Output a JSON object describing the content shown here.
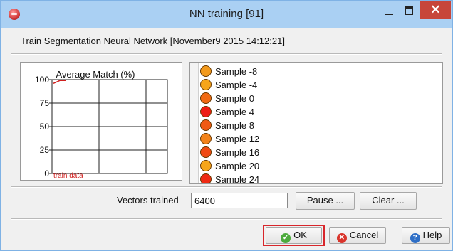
{
  "window": {
    "title": "NN training [91]",
    "close_glyph": "✕"
  },
  "header": {
    "label": "Train Segmentation Neural Network  [November9 2015 14:12:21]"
  },
  "chart_data": {
    "type": "line",
    "title": "Average Match (%)",
    "ylim": [
      0,
      100
    ],
    "yticks": [
      "100",
      "75",
      "50",
      "25",
      "0"
    ],
    "grid": true,
    "series": [
      {
        "name": "train data",
        "color": "#d0201f",
        "x": [
          0,
          1,
          2
        ],
        "y": [
          96,
          99,
          99
        ]
      }
    ],
    "legend_placement": "bottom-left"
  },
  "samples": [
    {
      "label": "Sample -8",
      "color": "#f39a1c"
    },
    {
      "label": "Sample -4",
      "color": "#f6a51a"
    },
    {
      "label": "Sample 0",
      "color": "#f16a14"
    },
    {
      "label": "Sample 4",
      "color": "#ef1c14"
    },
    {
      "label": "Sample 8",
      "color": "#f05a14"
    },
    {
      "label": "Sample 12",
      "color": "#f3831a"
    },
    {
      "label": "Sample 16",
      "color": "#f04a14"
    },
    {
      "label": "Sample 20",
      "color": "#f6a51a"
    },
    {
      "label": "Sample 24",
      "color": "#ef2a14"
    }
  ],
  "controls": {
    "vectors_label": "Vectors trained",
    "vectors_value": "6400",
    "pause_label": "Pause ...",
    "clear_label": "Clear ..."
  },
  "footer": {
    "ok_label": "OK",
    "cancel_label": "Cancel",
    "help_label": "Help"
  }
}
